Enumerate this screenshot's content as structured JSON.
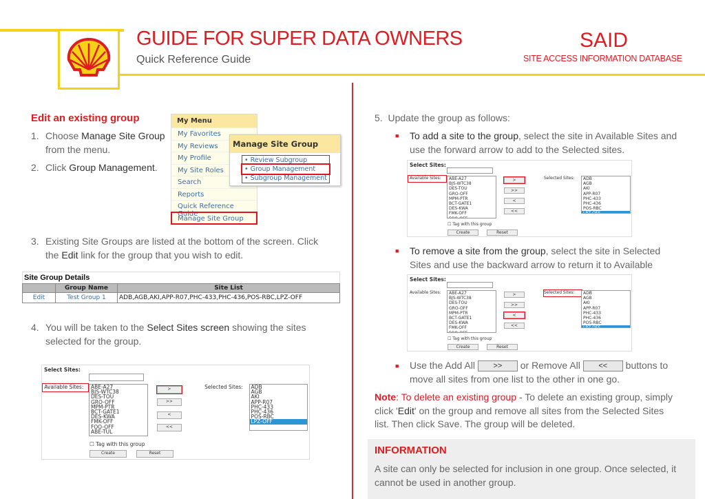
{
  "header": {
    "title": "GUIDE FOR SUPER DATA OWNERS",
    "subtitle": "Quick Reference Guide",
    "brand": "SAID",
    "brand_sub": "SITE ACCESS INFORMATION DATABASE",
    "logo": "shell-pecten-logo",
    "accent": "#dd1d21",
    "yellow": "#f7d117"
  },
  "left": {
    "heading": "Edit an existing group",
    "step1": {
      "num": "1.",
      "pre": "Choose ",
      "bold": "Manage Site Group",
      "post": " from the menu."
    },
    "step2": {
      "num": "2.",
      "pre": "Click ",
      "bold": "Group Management",
      "post": "."
    },
    "step3": {
      "num": "3.",
      "pre": "Existing Site Groups are listed at the bottom of the screen. Click the ",
      "bold": "Edit",
      "post": " link for the group that you wish to edit."
    },
    "step4": {
      "num": "4.",
      "pre": "You will be taken to the ",
      "bold": "Select Sites screen",
      "post": " showing the sites selected for the group."
    },
    "my_menu": {
      "title": "My Menu",
      "items": [
        "My Favorites",
        "My Reviews",
        "My Profile",
        "My Site Roles",
        "Search",
        "Reports",
        "Quick Reference Guide",
        "Manage Site Group"
      ]
    },
    "manage_popup": {
      "title": "Manage Site Group",
      "items": [
        "Review Subgroup",
        "Group Management",
        "Subgroup Management"
      ]
    },
    "site_group_details": {
      "title": "Site Group Details",
      "columns": [
        "",
        "Group Name",
        "Site List"
      ],
      "rows": [
        [
          "Edit",
          "Test Group 1",
          "ADB,AGB,AKI,APP-R07,PHC-433,PHC-436,POS-RBC,LPZ-OFF"
        ]
      ]
    }
  },
  "select_sites": {
    "title": "Select Sites:",
    "available_label": "Available Sites:",
    "selected_label": "Selected Sites:",
    "available": [
      "ABE-A27",
      "BJS-WTC38",
      "DES-TOU",
      "GRO-OFF",
      "MPM-PTR",
      "BCT-GATE1",
      "DES-KWA",
      "FMK-OFF",
      "FOO-OFF",
      "ABE-TUL"
    ],
    "selected": [
      "ADB",
      "AGB",
      "AKI",
      "APP-R07",
      "PHC-433",
      "PHC-436",
      "POS-RBC",
      "LPZ-OFF"
    ],
    "highlighted_selected": "LPZ-OFF",
    "buttons": [
      ">",
      ">>",
      "<",
      "<<"
    ],
    "tag_label": "Tag with this group",
    "create": "Create",
    "reset": "Reset"
  },
  "right": {
    "step5": {
      "num": "5.",
      "text": "Update the group as follows:"
    },
    "add": {
      "bold": "To add a site to the group",
      "text": ", select the site in Available Sites and use the forward arrow to add to the Selected sites."
    },
    "remove": {
      "bold": "To remove a site from the group",
      "text": ", select the site in Selected Sites and use the backward arrow to return it to Available Sites."
    },
    "addall": {
      "pre": "Use the Add All ",
      "btn1": ">>",
      "mid": " or Remove All ",
      "btn2": "<<",
      "post": " buttons to move all sites from one list to the other in one go."
    },
    "note": {
      "label": "Note",
      "red": ": To delete an existing group - ",
      "pre": "To delete an existing group, simply click '",
      "bold": "Edit",
      "post": "' on the group and remove all sites from the Selected Sites list. Then click Save. The group will be deleted."
    },
    "info": {
      "title": "INFORMATION",
      "text": "A site can only be selected for inclusion in one group. Once selected, it cannot be used in another group."
    }
  }
}
